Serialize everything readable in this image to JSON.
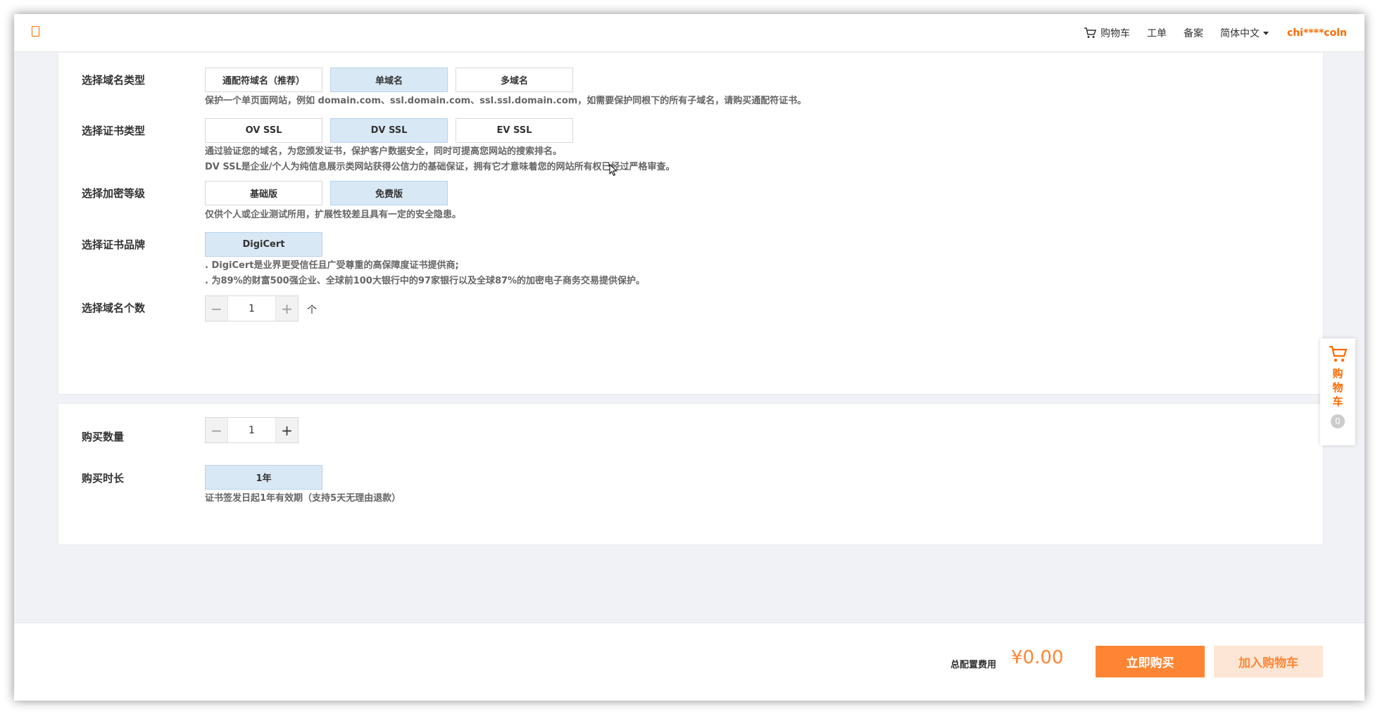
{
  "header": {
    "logo_icon": "logo-glyph",
    "cart_label": "购物车",
    "ticket_label": "工单",
    "filing_label": "备案",
    "language_label": "简体中文",
    "user_label": "chi****coln",
    "accent_color": "#ff6a00"
  },
  "domain_type": {
    "label": "选择域名类型",
    "options": [
      "通配符域名（推荐）",
      "单域名",
      "多域名"
    ],
    "selected": "单域名",
    "hint": "保护一个单页面网站，例如 domain.com、ssl.domain.com、ssl.ssl.domain.com，如需要保护同根下的所有子域名，请购买通配符证书。"
  },
  "cert_type": {
    "label": "选择证书类型",
    "options": [
      "OV SSL",
      "DV SSL",
      "EV SSL"
    ],
    "selected": "DV SSL",
    "hint_line1": "通过验证您的域名，为您颁发证书，保护客户数据安全，同时可提高您网站的搜索排名。",
    "hint_line2": "DV SSL是企业/个人为纯信息展示类网站获得公信力的基础保证，拥有它才意味着您的网站所有权已经过严格审查。"
  },
  "encryption_level": {
    "label": "选择加密等级",
    "options": [
      "基础版",
      "免费版"
    ],
    "selected": "免费版",
    "hint": "仅供个人或企业测试所用，扩展性较差且具有一定的安全隐患。"
  },
  "brand": {
    "label": "选择证书品牌",
    "options": [
      "DigiCert"
    ],
    "selected": "DigiCert",
    "hint_line1": ". DigiCert是业界更受信任且广受尊重的高保障度证书提供商;",
    "hint_line2": ". 为89%的财富500强企业、全球前100大银行中的97家银行以及全球87%的加密电子商务交易提供保护。"
  },
  "domain_count": {
    "label": "选择域名个数",
    "value": "1",
    "unit": "个"
  },
  "quantity": {
    "label": "购买数量",
    "value": "1"
  },
  "duration": {
    "label": "购买时长",
    "options": [
      "1年"
    ],
    "selected": "1年",
    "hint": "证书签发日起1年有效期（支持5天无理由退款）"
  },
  "float_cart": {
    "label": "购物车",
    "count": "0"
  },
  "footer": {
    "total_label": "总配置费用",
    "total_price": "¥0.00",
    "buy_label": "立即购买",
    "add_cart_label": "加入购物车"
  }
}
